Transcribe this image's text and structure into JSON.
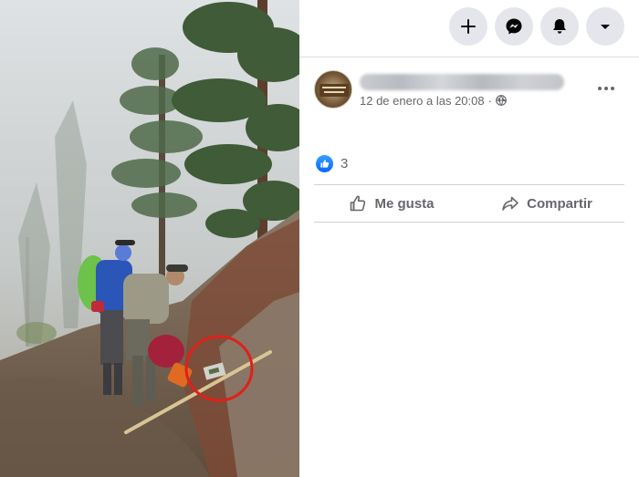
{
  "topbar": {
    "buttons": [
      {
        "icon": "plus-icon"
      },
      {
        "icon": "messenger-icon"
      },
      {
        "icon": "notifications-bell-icon"
      },
      {
        "icon": "account-menu-caret-icon"
      }
    ]
  },
  "post": {
    "author_name_blurred": true,
    "timestamp": "12 de enero a las 20:08",
    "separator": "·",
    "audience_icon": "globe-icon",
    "reactions": {
      "type": "like",
      "count": "3"
    },
    "actions": {
      "like_label": "Me gusta",
      "share_label": "Compartir"
    }
  },
  "photo": {
    "annotation": "red-circle-highlight"
  },
  "colors": {
    "accent_blue": "#0866ff",
    "secondary_text": "#65676b",
    "button_bg": "#e4e6eb",
    "divider": "#ced0d4",
    "annotation_red": "#e0201b"
  }
}
